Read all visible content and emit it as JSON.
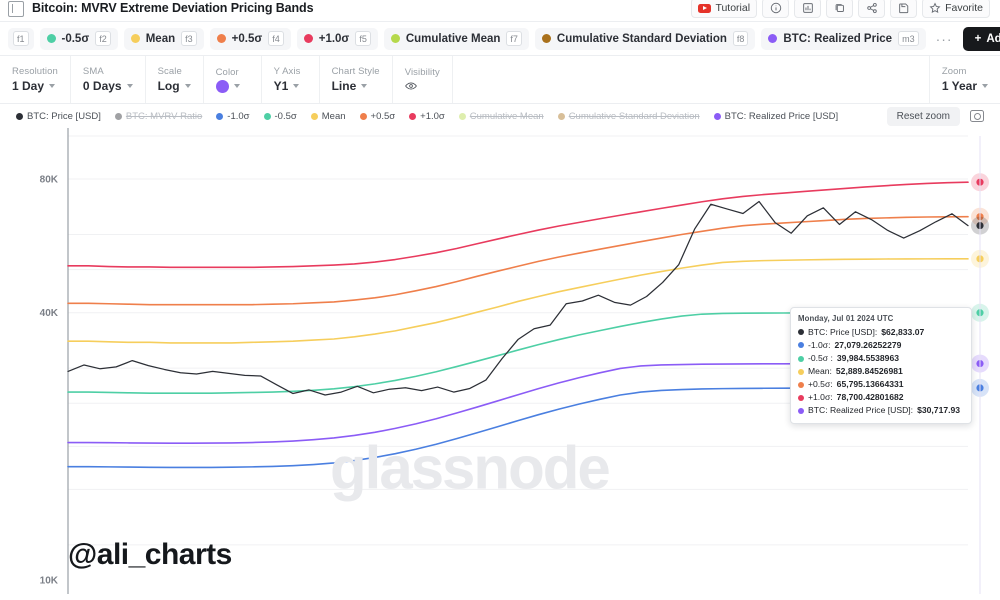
{
  "header": {
    "doc_icon": "document-icon",
    "title": "Bitcoin: MVRV Extreme Deviation Pricing Bands",
    "buttons": [
      {
        "name": "tutorial",
        "label": "Tutorial",
        "icon": "youtube-icon"
      },
      {
        "name": "info",
        "label": "",
        "icon": "info-icon"
      },
      {
        "name": "dashboard",
        "label": "",
        "icon": "dashboard-icon"
      },
      {
        "name": "copy",
        "label": "",
        "icon": "copy-icon"
      },
      {
        "name": "share",
        "label": "",
        "icon": "share-icon"
      },
      {
        "name": "save",
        "label": "",
        "icon": "save-icon"
      },
      {
        "name": "favorite",
        "label": "Favorite",
        "icon": "star-icon"
      }
    ]
  },
  "series_tabs": {
    "add_label": "Add",
    "overflow_label": "···",
    "items": [
      {
        "label": "",
        "key": "f1",
        "color": "",
        "has_dot": false
      },
      {
        "label": "-0.5σ",
        "key": "f2",
        "color": "#4ecfa5",
        "has_dot": true
      },
      {
        "label": "Mean",
        "key": "f3",
        "color": "#f6ce5c",
        "has_dot": true
      },
      {
        "label": "+0.5σ",
        "key": "f4",
        "color": "#ef7f4b",
        "has_dot": true
      },
      {
        "label": "+1.0σ",
        "key": "f5",
        "color": "#e83b5e",
        "has_dot": true
      },
      {
        "label": "Cumulative Mean",
        "key": "f7",
        "color": "#b6d94c",
        "has_dot": true
      },
      {
        "label": "Cumulative Standard Deviation",
        "key": "f8",
        "color": "#a9711c",
        "has_dot": true
      },
      {
        "label": "BTC: Realized Price",
        "key": "m3",
        "color": "#8b5cf6",
        "has_dot": true
      }
    ]
  },
  "controls": [
    {
      "label": "Resolution",
      "value": "1 Day",
      "type": "select"
    },
    {
      "label": "SMA",
      "value": "0 Days",
      "type": "select"
    },
    {
      "label": "Scale",
      "value": "Log",
      "type": "select"
    },
    {
      "label": "Color",
      "value": "",
      "type": "color",
      "color": "#8b5cf6"
    },
    {
      "label": "Y Axis",
      "value": "Y1",
      "type": "select"
    },
    {
      "label": "Chart Style",
      "value": "Line",
      "type": "select"
    },
    {
      "label": "Visibility",
      "value": "",
      "type": "eye"
    }
  ],
  "zoom_control": {
    "label": "Zoom",
    "value": "1 Year"
  },
  "chart_toolbar": {
    "reset_zoom": "Reset zoom",
    "camera_icon": "camera-icon"
  },
  "chart_data": {
    "type": "line",
    "title": "Bitcoin: MVRV Extreme Deviation Pricing Bands",
    "xlabel": "",
    "ylabel": "",
    "scale": "log",
    "ylim": [
      10000,
      100000
    ],
    "yticks": [
      10000,
      40000,
      80000
    ],
    "ytick_labels": [
      "10K",
      "40K",
      "80K"
    ],
    "grid": true,
    "legend_position": "top-left",
    "watermark": "glassnode",
    "handle_watermark": "@ali_charts",
    "legend": [
      {
        "label": "BTC: Price [USD]",
        "color": "#2c2f36",
        "visible": true
      },
      {
        "label": "BTC: MVRV Ratio",
        "color": "#2c2f36",
        "visible": false
      },
      {
        "label": "-1.0σ",
        "color": "#4a7fe0",
        "visible": true
      },
      {
        "label": "-0.5σ",
        "color": "#4ecfa5",
        "visible": true
      },
      {
        "label": "Mean",
        "color": "#f6ce5c",
        "visible": true
      },
      {
        "label": "+0.5σ",
        "color": "#ef7f4b",
        "visible": true
      },
      {
        "label": "+1.0σ",
        "color": "#e83b5e",
        "visible": true
      },
      {
        "label": "Cumulative Mean",
        "color": "#b6d94c",
        "visible": false
      },
      {
        "label": "Cumulative Standard Deviation",
        "color": "#a9711c",
        "visible": false
      },
      {
        "label": "BTC: Realized Price [USD]",
        "color": "#8b5cf6",
        "visible": true
      }
    ],
    "series": [
      {
        "name": "+1.0σ",
        "color": "#e83b5e",
        "end_value": 78700,
        "values": [
          51000,
          51000,
          50800,
          50700,
          50700,
          50600,
          50600,
          50600,
          50600,
          50600,
          50700,
          50800,
          51000,
          51200,
          51500,
          52000,
          52700,
          53600,
          54600,
          55800,
          57200,
          58600,
          60000,
          61400,
          62700,
          63900,
          65100,
          66300,
          67500,
          68700,
          69900,
          71100,
          72200,
          73100,
          73800,
          74400,
          75000,
          75600,
          76200,
          76800,
          77300,
          77800,
          78200,
          78500,
          78700
        ]
      },
      {
        "name": "+0.5σ",
        "color": "#ef7f4b",
        "end_value": 65795,
        "values": [
          42000,
          42000,
          41900,
          41800,
          41700,
          41700,
          41700,
          41700,
          41700,
          41700,
          41800,
          41900,
          42100,
          42300,
          42700,
          43200,
          43900,
          44800,
          45800,
          47000,
          48300,
          49600,
          50900,
          52200,
          53400,
          54500,
          55600,
          56700,
          57800,
          58900,
          60000,
          61000,
          62000,
          62800,
          63300,
          63700,
          64100,
          64500,
          64900,
          65200,
          65400,
          65600,
          65700,
          65780,
          65795
        ]
      },
      {
        "name": "Mean",
        "color": "#f6ce5c",
        "end_value": 52889,
        "values": [
          34500,
          34500,
          34400,
          34300,
          34300,
          34200,
          34200,
          34200,
          34200,
          34300,
          34400,
          34500,
          34700,
          34900,
          35300,
          35800,
          36400,
          37200,
          38000,
          39000,
          40100,
          41200,
          42400,
          43500,
          44600,
          45600,
          46600,
          47600,
          48600,
          49500,
          50400,
          51200,
          51900,
          52200,
          52400,
          52500,
          52600,
          52700,
          52750,
          52800,
          52840,
          52860,
          52875,
          52885,
          52889
        ]
      },
      {
        "name": "-0.5σ",
        "color": "#4ecfa5",
        "end_value": 39984,
        "values": [
          26500,
          26500,
          26450,
          26400,
          26350,
          26350,
          26350,
          26350,
          26400,
          26450,
          26500,
          26600,
          26750,
          26950,
          27250,
          27650,
          28150,
          28750,
          29450,
          30250,
          31100,
          32000,
          32950,
          33900,
          34800,
          35650,
          36450,
          37250,
          38000,
          38700,
          39300,
          39700,
          39850,
          39900,
          39920,
          39935,
          39945,
          39955,
          39962,
          39968,
          39973,
          39977,
          39980,
          39982,
          39984
        ]
      },
      {
        "name": "-1.0σ",
        "color": "#4a7fe0",
        "end_value": 27079,
        "values": [
          18000,
          18000,
          17980,
          17960,
          17940,
          17930,
          17930,
          17930,
          17950,
          17980,
          18020,
          18090,
          18200,
          18350,
          18580,
          18880,
          19250,
          19700,
          20220,
          20820,
          21460,
          22140,
          22850,
          23570,
          24260,
          24910,
          25520,
          26100,
          26500,
          26720,
          26850,
          26930,
          26980,
          27010,
          27030,
          27045,
          27055,
          27062,
          27068,
          27072,
          27075,
          27077,
          27078,
          27079,
          27079
        ]
      },
      {
        "name": "BTC: Realized Price [USD]",
        "color": "#8b5cf6",
        "end_value": 30717,
        "values": [
          20400,
          20400,
          20380,
          20360,
          20340,
          20330,
          20330,
          20340,
          20360,
          20400,
          20460,
          20560,
          20700,
          20890,
          21160,
          21510,
          21950,
          22470,
          23080,
          23770,
          24520,
          25310,
          26140,
          26980,
          27790,
          28560,
          29280,
          29960,
          30350,
          30500,
          30570,
          30620,
          30650,
          30665,
          30678,
          30687,
          30694,
          30700,
          30705,
          30709,
          30712,
          30714,
          30716,
          30717,
          30717
        ]
      },
      {
        "name": "BTC: Price [USD]",
        "color": "#2c2f36",
        "end_value": 62833,
        "values": [
          29500,
          30500,
          29900,
          30200,
          31200,
          30400,
          29800,
          29300,
          29100,
          29500,
          29200,
          28900,
          28800,
          27500,
          26300,
          26800,
          26100,
          26500,
          27300,
          26400,
          26900,
          27100,
          26700,
          27200,
          26500,
          27000,
          28200,
          31500,
          34800,
          36800,
          37500,
          41900,
          42500,
          43800,
          42200,
          41600,
          43500,
          46800,
          51300,
          61800,
          70200,
          68500,
          66900,
          71200,
          63800,
          60400,
          66100,
          68900,
          63200,
          67500,
          64800,
          61300,
          58900,
          61200,
          64100,
          66800,
          62833
        ]
      }
    ]
  },
  "tooltip": {
    "date": "Monday, Jul 01 2024 UTC",
    "rows": [
      {
        "color": "#2c2f36",
        "label": "BTC: Price [USD]:",
        "value": "$62,833.07",
        "bold": true
      },
      {
        "color": "#4a7fe0",
        "label": "-1.0σ:",
        "value": "27,079.26252279",
        "bold": true
      },
      {
        "color": "#4ecfa5",
        "label": "-0.5σ :",
        "value": "39,984.5538963",
        "bold": true
      },
      {
        "color": "#f6ce5c",
        "label": "Mean:",
        "value": "52,889.84526981",
        "bold": true
      },
      {
        "color": "#ef7f4b",
        "label": "+0.5σ:",
        "value": "65,795.13664331",
        "bold": true
      },
      {
        "color": "#e83b5e",
        "label": "+1.0σ:",
        "value": "78,700.42801682",
        "bold": true
      },
      {
        "color": "#8b5cf6",
        "label": "BTC: Realized Price [USD]:",
        "value": "$30,717.93",
        "bold": true
      }
    ]
  }
}
